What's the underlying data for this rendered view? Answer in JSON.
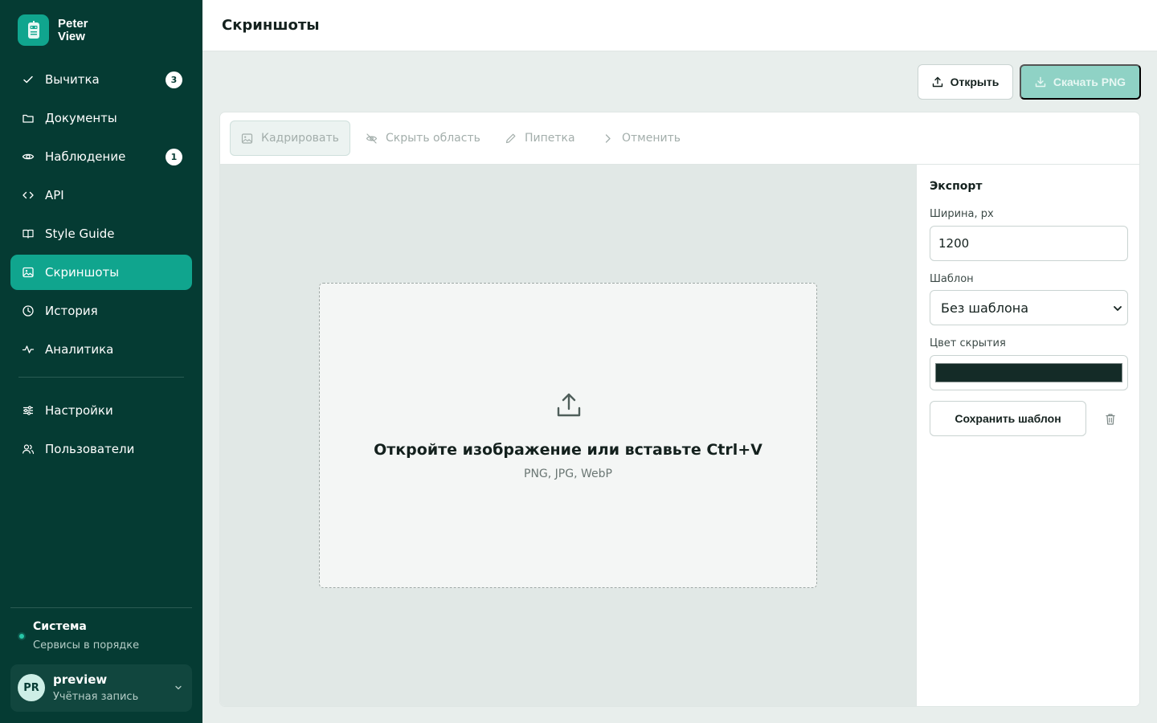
{
  "brand": {
    "line1": "Peter",
    "line2": "View",
    "logo_icon": "robot-face-icon",
    "accent": "#10a58e"
  },
  "nav": [
    {
      "id": "review",
      "label": "Вычитка",
      "icon": "check-icon",
      "badge": "3"
    },
    {
      "id": "documents",
      "label": "Документы",
      "icon": "folder-icon"
    },
    {
      "id": "monitoring",
      "label": "Наблюдение",
      "icon": "eye-icon",
      "badge": "1"
    },
    {
      "id": "api",
      "label": "API",
      "icon": "code-icon"
    },
    {
      "id": "style-guide",
      "label": "Style Guide",
      "icon": "book-icon"
    },
    {
      "id": "screenshots",
      "label": "Скриншоты",
      "icon": "image-icon",
      "active": true
    },
    {
      "id": "history",
      "label": "История",
      "icon": "clock-icon"
    },
    {
      "id": "analytics",
      "label": "Аналитика",
      "icon": "activity-icon"
    }
  ],
  "nav_secondary": [
    {
      "id": "settings",
      "label": "Настройки",
      "icon": "sliders-icon"
    },
    {
      "id": "users",
      "label": "Пользователи",
      "icon": "users-icon"
    }
  ],
  "system": {
    "title": "Система",
    "status": "Сервисы в порядке",
    "status_color": "#27c7a8"
  },
  "account": {
    "initials": "PR",
    "name": "preview",
    "subtitle": "Учётная запись"
  },
  "page": {
    "title": "Скриншоты"
  },
  "actions": {
    "open_label": "Открыть",
    "download_label": "Скачать PNG"
  },
  "toolbar": {
    "crop": "Кадрировать",
    "hide_area": "Скрыть область",
    "eyedropper": "Пипетка",
    "undo": "Отменить"
  },
  "dropzone": {
    "title": "Откройте изображение или вставьте Ctrl+V",
    "formats": "PNG, JPG, WebP"
  },
  "export": {
    "title": "Экспорт",
    "width_label": "Ширина, px",
    "width_value": "1200",
    "template_label": "Шаблон",
    "template_value": "Без шаблона",
    "color_label": "Цвет скрытия",
    "color_value": "#142b27",
    "save_template": "Сохранить шаблон"
  }
}
